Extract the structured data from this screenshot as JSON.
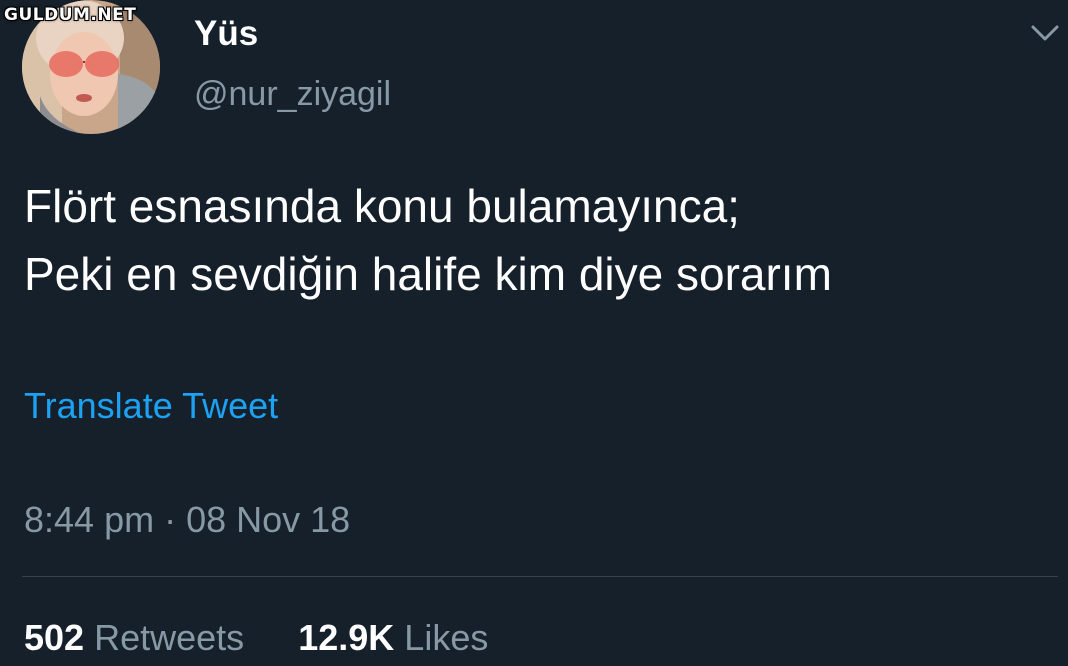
{
  "watermark": "GULDUM.NET",
  "user": {
    "display_name": "Yüs",
    "handle": "@nur_ziyagil"
  },
  "tweet": {
    "lines": [
      "Flört esnasında konu bulamayınca;",
      "Peki en sevdiğin halife kim diye sorarım"
    ],
    "translate_label": "Translate Tweet",
    "timestamp": "8:44 pm · 08 Nov 18"
  },
  "stats": {
    "retweets_count": "502",
    "retweets_label": "Retweets",
    "likes_count": "12.9K",
    "likes_label": "Likes"
  },
  "icons": {
    "menu": "chevron-down-icon"
  },
  "colors": {
    "background": "#15202b",
    "primary_text": "#ffffff",
    "secondary_text": "#8899a6",
    "link": "#1da1f2",
    "divider": "#38444d"
  }
}
